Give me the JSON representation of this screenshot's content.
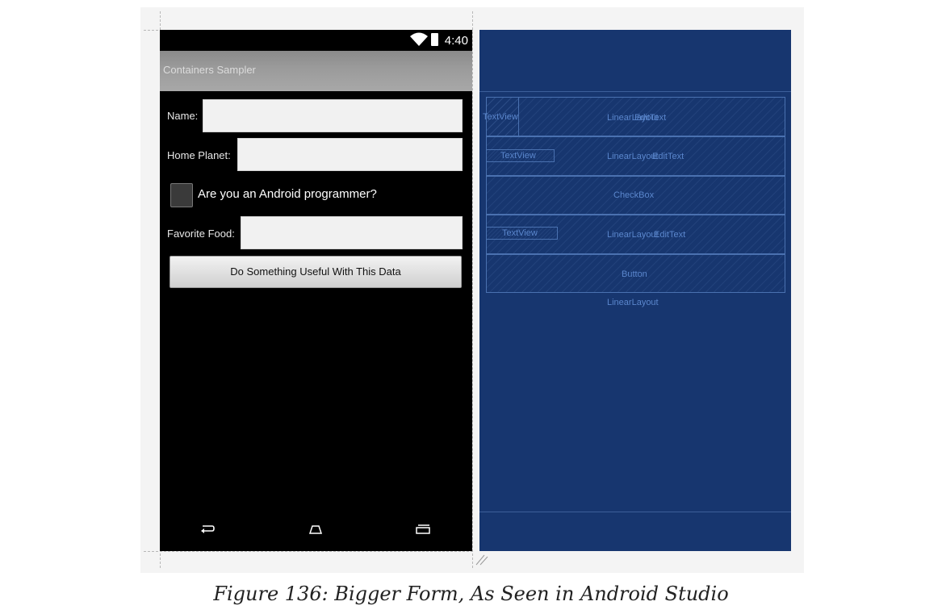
{
  "phone": {
    "status_time": "4:40",
    "app_title": "Containers Sampler",
    "name_label": "Name:",
    "home_planet_label": "Home Planet:",
    "checkbox_label": "Are you an Android programmer?",
    "favorite_food_label": "Favorite Food:",
    "button_label": "Do Something Useful With This Data",
    "nav_icons": [
      "back-icon",
      "home-icon",
      "recents-icon"
    ]
  },
  "blueprint": {
    "row1": {
      "textview": "TextView",
      "linearlayout": "LinearLayout",
      "edittext": "EditText"
    },
    "row2": {
      "textview": "TextView",
      "linearlayout": "LinearLayout",
      "edittext": "EditText"
    },
    "row3": {
      "checkbox": "CheckBox"
    },
    "row4": {
      "textview": "TextView",
      "linearlayout": "LinearLayout",
      "edittext": "EditText"
    },
    "row5": {
      "button": "Button"
    },
    "root": "LinearLayout"
  },
  "caption": "Figure 136: Bigger Form, As Seen in Android Studio",
  "colors": {
    "blueprint_bg": "#17366f",
    "blueprint_text": "#5a86cc",
    "phone_bg": "#000000",
    "actionbar": "#9a9a9a"
  }
}
